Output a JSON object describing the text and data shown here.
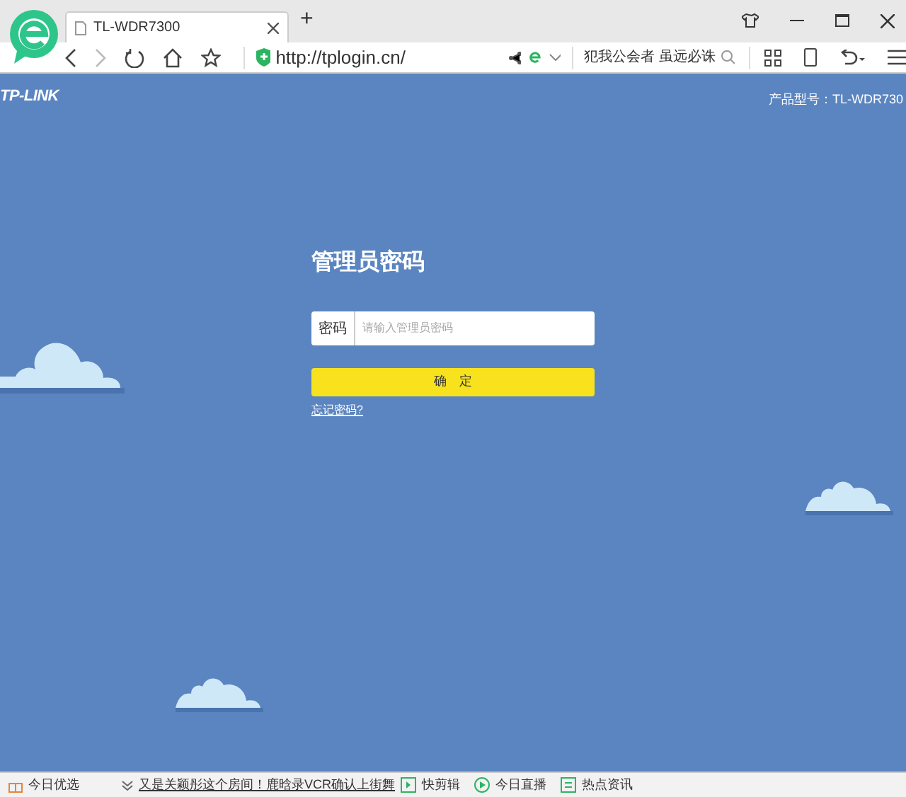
{
  "browser": {
    "tabs": [
      {
        "title": "TL-WDR7300",
        "selected": true
      }
    ],
    "new_tab": "+",
    "url": "http://tplogin.cn/",
    "search_text": "犯我公会者 虽远必诛"
  },
  "page": {
    "logo": "TP-LINK",
    "product": "产品型号：TL-WDR730",
    "heading": "管理员密码",
    "password_label": "密码",
    "password_placeholder": "请输入管理员密码",
    "confirm": "确　定",
    "forgot": "忘记密码?"
  },
  "status_bar": [
    {
      "kind": "gift",
      "label": "今日优选"
    },
    {
      "kind": "news",
      "label": "又是关颖彤这个房间！鹿晗录VCR确认上街舞"
    },
    {
      "kind": "clip",
      "label": "快剪辑"
    },
    {
      "kind": "play",
      "label": "今日直播"
    },
    {
      "kind": "hot",
      "label": "热点资讯"
    }
  ]
}
